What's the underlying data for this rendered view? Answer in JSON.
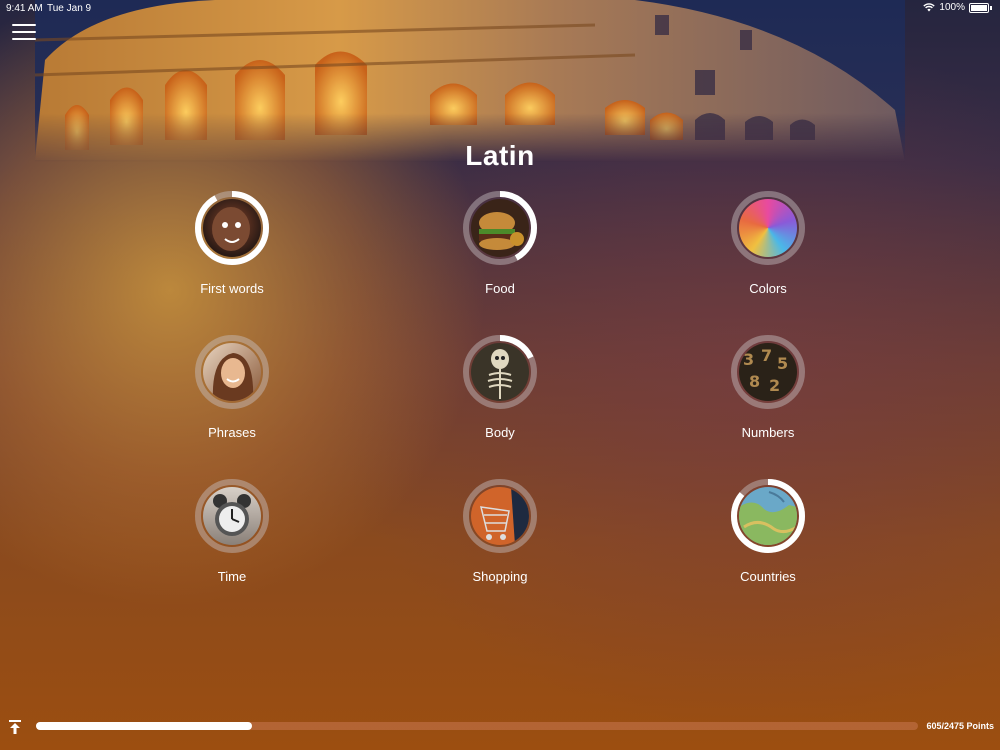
{
  "status": {
    "time": "9:41 AM",
    "date": "Tue Jan 9",
    "battery": "100%"
  },
  "title": "Latin",
  "topics": [
    {
      "label": "First words",
      "progress": 0.92,
      "image": "child-face-photo"
    },
    {
      "label": "Food",
      "progress": 0.42,
      "image": "burger-photo"
    },
    {
      "label": "Colors",
      "progress": 0,
      "image": "paint-colors-photo"
    },
    {
      "label": "Phrases",
      "progress": 0,
      "image": "woman-smiling-photo"
    },
    {
      "label": "Body",
      "progress": 0.18,
      "image": "skeleton-photo"
    },
    {
      "label": "Numbers",
      "progress": 0,
      "image": "metal-numbers-photo"
    },
    {
      "label": "Time",
      "progress": 0,
      "image": "alarm-clock-photo"
    },
    {
      "label": "Shopping",
      "progress": 0,
      "image": "shopping-cart-photo"
    },
    {
      "label": "Countries",
      "progress": 0.86,
      "image": "map-photo"
    }
  ],
  "footer": {
    "points_text": "605/2475 Points",
    "points": 605,
    "total": 2475
  },
  "colors": {
    "ring_track": "#c8c0c4",
    "ring_fill": "#ffffff"
  }
}
